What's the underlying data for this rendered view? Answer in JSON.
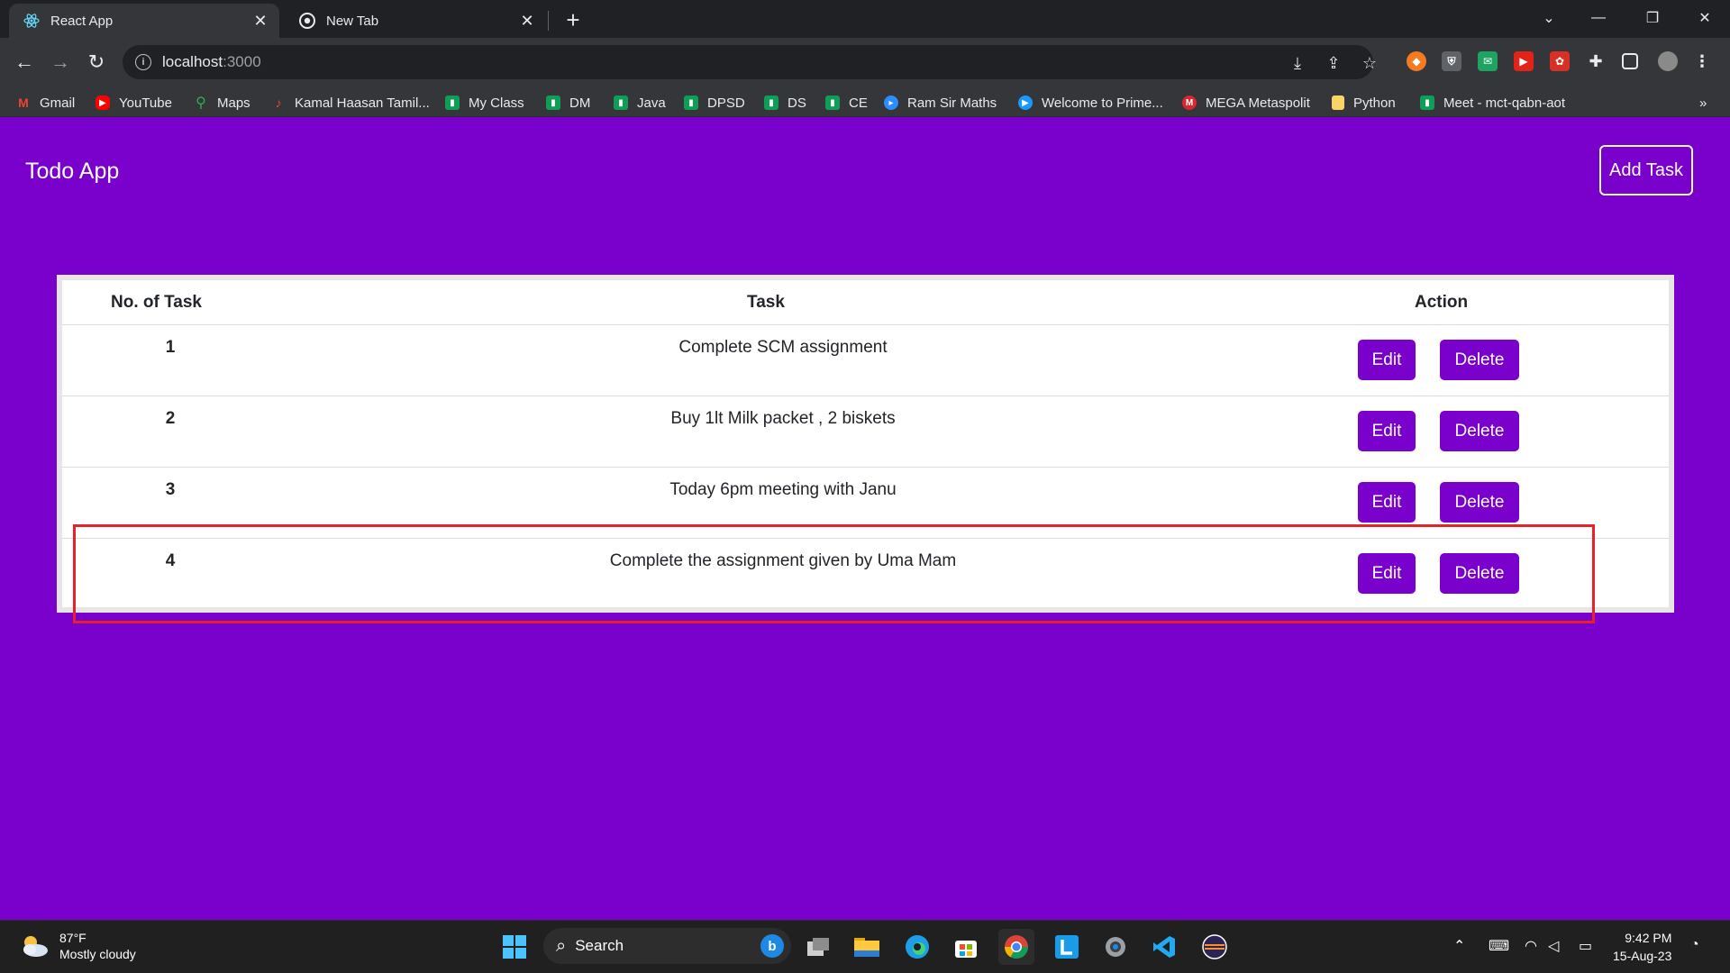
{
  "browser": {
    "tabs": [
      {
        "title": "React App",
        "active": true
      },
      {
        "title": "New Tab",
        "active": false
      }
    ],
    "url_host": "localhost",
    "url_port": ":3000",
    "bookmarks": [
      "Gmail",
      "YouTube",
      "Maps",
      "Kamal Haasan Tamil...",
      "My Class",
      "DM",
      "Java",
      "DPSD",
      "DS",
      "CE",
      "Ram Sir Maths",
      "Welcome to Prime...",
      "MEGA Metaspolit",
      "Python",
      "Meet - mct-qabn-aot"
    ],
    "bookmarks_overflow": "»"
  },
  "app": {
    "brand": "Todo App",
    "add_task_label": "Add Task",
    "table": {
      "headers": [
        "No. of Task",
        "Task",
        "Action"
      ],
      "rows": [
        {
          "num": "1",
          "task": "Complete SCM assignment",
          "edit": "Edit",
          "delete": "Delete"
        },
        {
          "num": "2",
          "task": "Buy 1lt Milk packet , 2 biskets",
          "edit": "Edit",
          "delete": "Delete"
        },
        {
          "num": "3",
          "task": "Today 6pm meeting with Janu",
          "edit": "Edit",
          "delete": "Delete"
        },
        {
          "num": "4",
          "task": "Complete the assignment given by Uma Mam",
          "edit": "Edit",
          "delete": "Delete"
        }
      ]
    }
  },
  "taskbar": {
    "temperature": "87°F",
    "weather": "Mostly cloudy",
    "search_label": "Search",
    "time": "9:42 PM",
    "date": "15-Aug-23"
  },
  "colors": {
    "page_bg": "#7a00cc",
    "button_bg": "#7a00cc",
    "highlight": "#e8202a"
  }
}
